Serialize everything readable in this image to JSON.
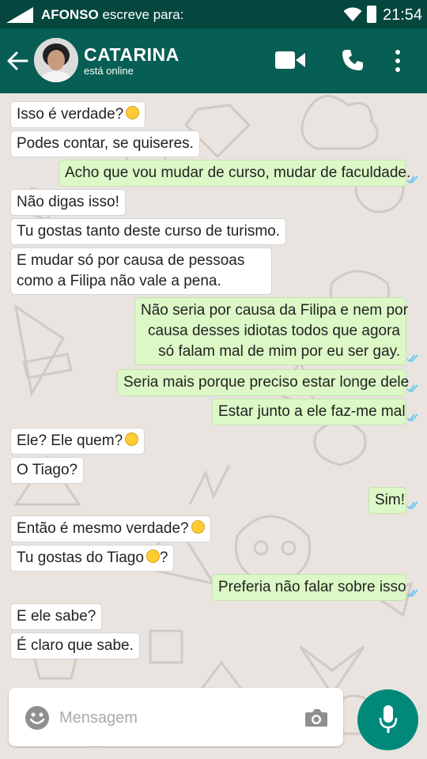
{
  "status_bar": {
    "notification_name": "AFONSO",
    "notification_suffix": "escreve para:",
    "time": "21:54",
    "icons": [
      "signal-icon",
      "wifi-icon",
      "battery-icon"
    ]
  },
  "header": {
    "contact_name": "CATARINA",
    "presence": "está online",
    "icons": [
      "back-arrow-icon",
      "avatar",
      "video-call-icon",
      "phone-call-icon",
      "more-vert-icon"
    ]
  },
  "messages": [
    {
      "side": "in",
      "text": "Isso é verdade?",
      "emoji": true
    },
    {
      "side": "in",
      "text": "Podes contar, se quiseres."
    },
    {
      "side": "out",
      "text": "Acho que vou mudar de curso, mudar de faculdade.",
      "read": true
    },
    {
      "side": "in",
      "text": "Não digas isso!"
    },
    {
      "side": "in",
      "text": "Tu gostas tanto deste curso de turismo."
    },
    {
      "side": "in",
      "lines": [
        "E mudar só por causa de pessoas",
        "como a Filipa não vale a pena."
      ]
    },
    {
      "side": "out",
      "lines": [
        "Não seria por causa da Filipa e nem por",
        "causa desses idiotas todos que agora",
        "só falam mal de mim por eu ser gay."
      ],
      "read": true
    },
    {
      "side": "out",
      "text": "Seria mais porque preciso estar longe dele",
      "read": true
    },
    {
      "side": "out",
      "text": "Estar junto a ele faz-me mal",
      "read": true
    },
    {
      "side": "in",
      "text": "Ele? Ele quem?",
      "emoji": true
    },
    {
      "side": "in",
      "text": "O Tiago?"
    },
    {
      "side": "out",
      "text": "Sim!",
      "read": true
    },
    {
      "side": "in",
      "text": "Então é mesmo verdade?",
      "emoji": true
    },
    {
      "side": "in",
      "text_before": "Tu gostas do Tiago",
      "text_after": "?",
      "emoji": true
    },
    {
      "side": "out",
      "text": "Preferia não falar sobre isso",
      "read": true
    },
    {
      "side": "in",
      "text": "E ele sabe?"
    },
    {
      "side": "in",
      "text": "É claro que sabe."
    }
  ],
  "composer": {
    "placeholder": "Mensagem",
    "icons": [
      "emoji-icon",
      "camera-icon",
      "microphone-icon"
    ]
  },
  "colors": {
    "header": "#075e54",
    "status_bar": "#05473e",
    "outgoing_bubble": "#dcf8c6",
    "incoming_bubble": "#ffffff",
    "read_tick": "#4fc3f7",
    "mic_button": "#00897b"
  }
}
